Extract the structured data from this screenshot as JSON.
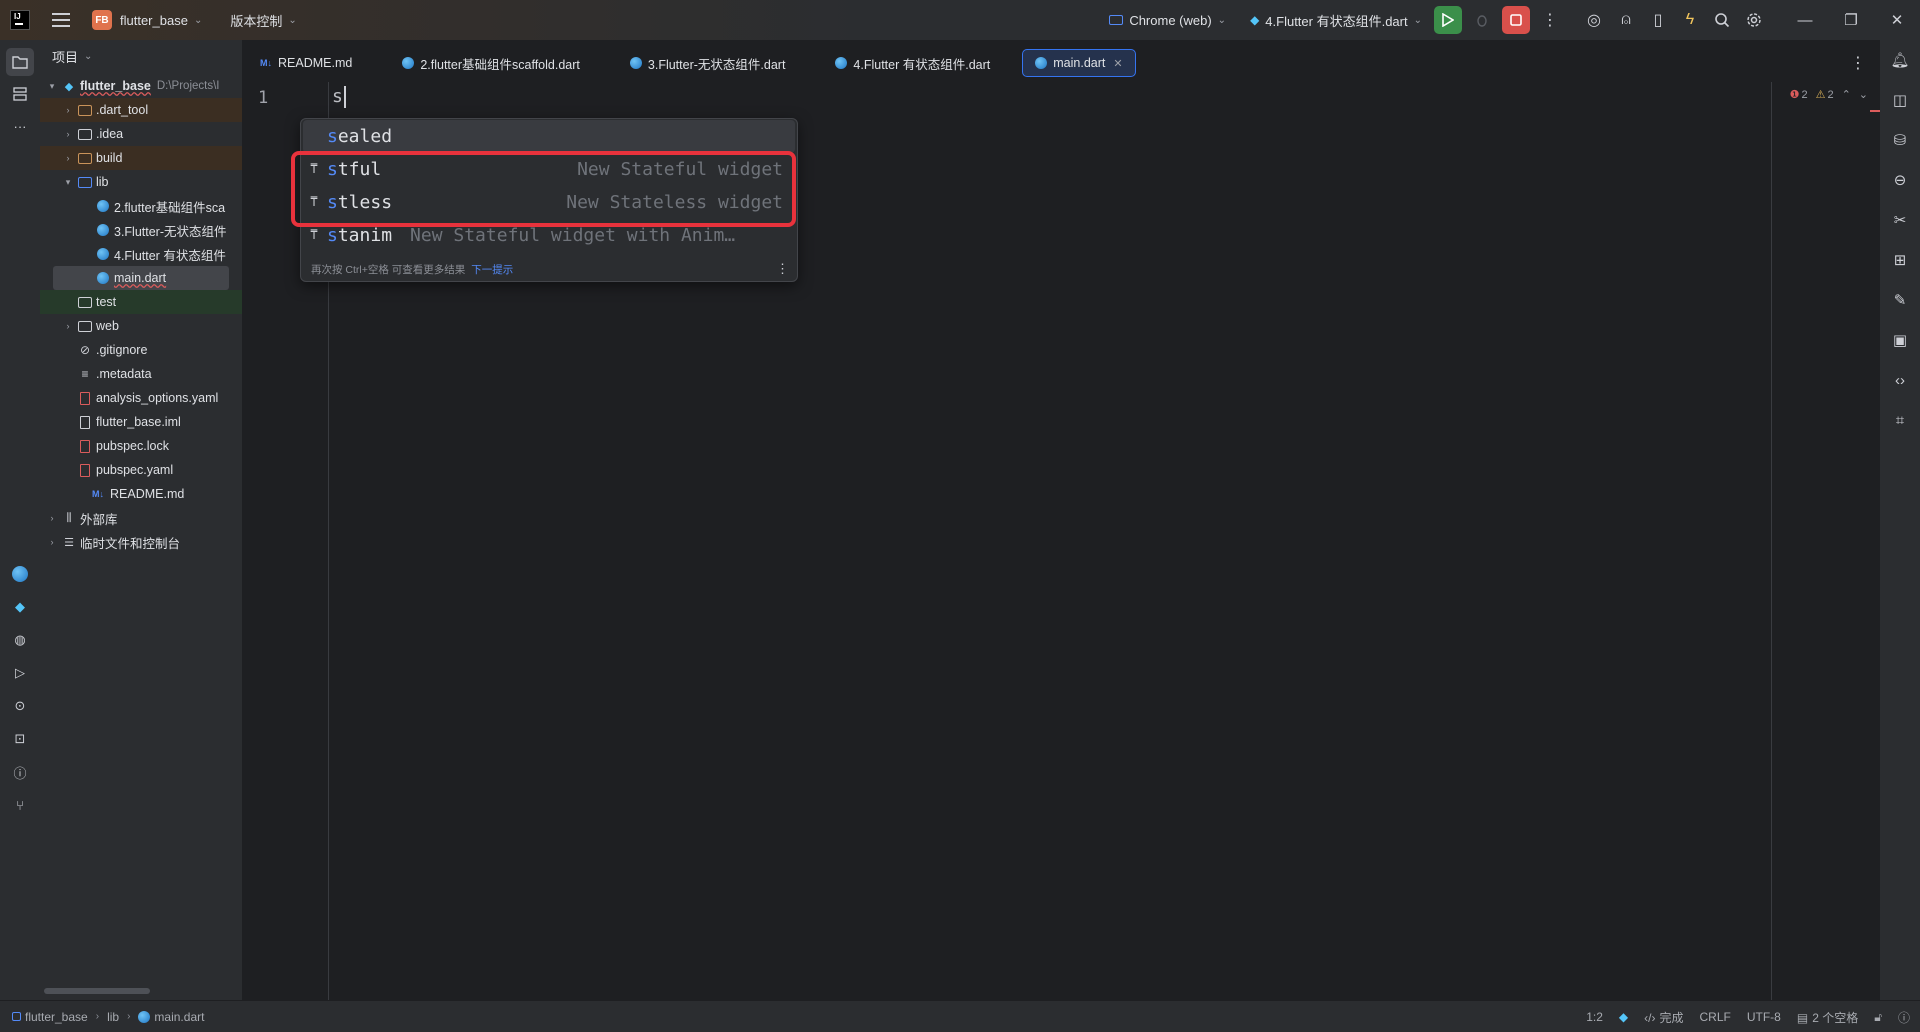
{
  "titlebar": {
    "project_badge": "FB",
    "project_name": "flutter_base",
    "vcs_menu": "版本控制",
    "run_target": "Chrome (web)",
    "run_config": "4.Flutter 有状态组件.dart"
  },
  "project_panel": {
    "title": "项目",
    "root_name": "flutter_base",
    "root_path": "D:\\Projects\\I",
    "items": [
      {
        "label": ".dart_tool"
      },
      {
        "label": ".idea"
      },
      {
        "label": "build"
      },
      {
        "label": "lib"
      },
      {
        "label": "2.flutter基础组件sca"
      },
      {
        "label": "3.Flutter-无状态组件"
      },
      {
        "label": "4.Flutter 有状态组件"
      },
      {
        "label": "main.dart"
      },
      {
        "label": "test"
      },
      {
        "label": "web"
      },
      {
        "label": ".gitignore"
      },
      {
        "label": ".metadata"
      },
      {
        "label": "analysis_options.yaml"
      },
      {
        "label": "flutter_base.iml"
      },
      {
        "label": "pubspec.lock"
      },
      {
        "label": "pubspec.yaml"
      },
      {
        "label": "README.md"
      },
      {
        "label": "外部库"
      },
      {
        "label": "临时文件和控制台"
      }
    ],
    "md_badge": "M↓"
  },
  "tabs": [
    {
      "label": "README.md"
    },
    {
      "label": "2.flutter基础组件scaffold.dart"
    },
    {
      "label": "3.Flutter-无状态组件.dart"
    },
    {
      "label": "4.Flutter 有状态组件.dart"
    },
    {
      "label": "main.dart"
    }
  ],
  "editor": {
    "line_number": "1",
    "code_text": "s",
    "errors": "2",
    "warnings": "2"
  },
  "completion": {
    "items": [
      {
        "prefix": "s",
        "rest": "ealed",
        "desc": ""
      },
      {
        "prefix": "s",
        "rest": "tful",
        "desc": "New Stateful widget"
      },
      {
        "prefix": "s",
        "rest": "tless",
        "desc": "New Stateless widget"
      },
      {
        "prefix": "s",
        "rest": "tanim",
        "desc": "New Stateful widget with Anim…"
      }
    ],
    "footer_hint": "再次按 Ctrl+空格 可查看更多结果",
    "footer_link": "下一提示"
  },
  "statusbar": {
    "crumbs": [
      "flutter_base",
      "lib",
      "main.dart"
    ],
    "position": "1:2",
    "lsp_status": "完成",
    "line_sep": "CRLF",
    "encoding": "UTF-8",
    "indent": "2 个空格"
  },
  "colors": {
    "accent": "#3574f0",
    "highlight_box": "#e8323c",
    "run_green": "#3b8f4a",
    "stop_red": "#d9504b"
  }
}
